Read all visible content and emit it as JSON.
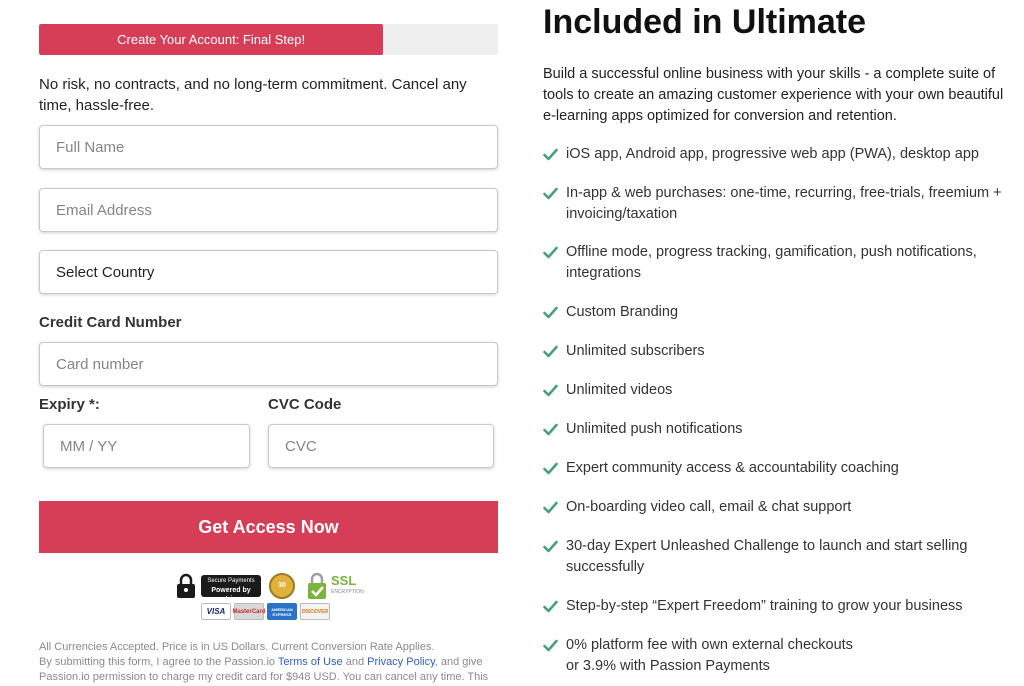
{
  "form": {
    "progress_label": "Create Your Account: Final Step!",
    "progress_value": 0.75,
    "intro": "No risk, no contracts, and no long-term commitment. Cancel any time, hassle-free.",
    "full_name_placeholder": "Full Name",
    "email_placeholder": "Email Address",
    "country_select": "Select Country",
    "credit_card_label": "Credit Card Number",
    "card_number_placeholder": "Card number",
    "expiry_label": "Expiry *:",
    "expiry_placeholder": "MM / YY",
    "cvc_label": "CVC Code",
    "cvc_placeholder": "CVC",
    "submit_label": "Get Access Now"
  },
  "badges": {
    "stripe_top": "Secure Payments",
    "stripe_bottom": "Powered by stripe",
    "seal_text": "30",
    "ssl_text": "SSL",
    "ssl_sub": "ENCRYPTION",
    "cards": [
      "VISA",
      "MasterCard",
      "AMERICAN EXPRESS",
      "DISCOVER"
    ]
  },
  "legal": {
    "line1": "All Currencies Accepted. Price is in US Dollars. Current Conversion Rate Applies.",
    "line2_a": "By submitting this form, I agree to the Passion.io ",
    "terms_link": "Terms of Use",
    "line2_b": " and ",
    "privacy_link": "Privacy Policy",
    "line2_c": ", and give",
    "line3": "Passion.io permission to charge my credit card for $948 USD. You can cancel any time. This"
  },
  "plan": {
    "title": "Included in Ultimate",
    "description": "Build a successful online business with your skills - a complete suite of tools to create an amazing customer experience with your own beautiful e-learning apps optimized for conversion and retention.",
    "features": [
      "iOS app, Android app, progressive web app (PWA), desktop app",
      "In-app & web purchases: one-time, recurring, free-trials, freemium + invoicing/taxation",
      "Offline mode, progress tracking, gamification, push notifications, integrations",
      "Custom Branding",
      "Unlimited subscribers",
      "Unlimited videos",
      "Unlimited push notifications",
      "Expert community access & accountability coaching",
      "On-boarding video call, email & chat support",
      "30-day Expert Unleashed Challenge to launch and start selling successfully",
      "Step-by-step “Expert Freedom” training to grow your business",
      "0% platform fee with own external checkouts\nor 3.9% with Passion Payments"
    ]
  },
  "colors": {
    "accent": "#d63d57",
    "check": "#4a9e7a",
    "link": "#2f5fbf"
  }
}
